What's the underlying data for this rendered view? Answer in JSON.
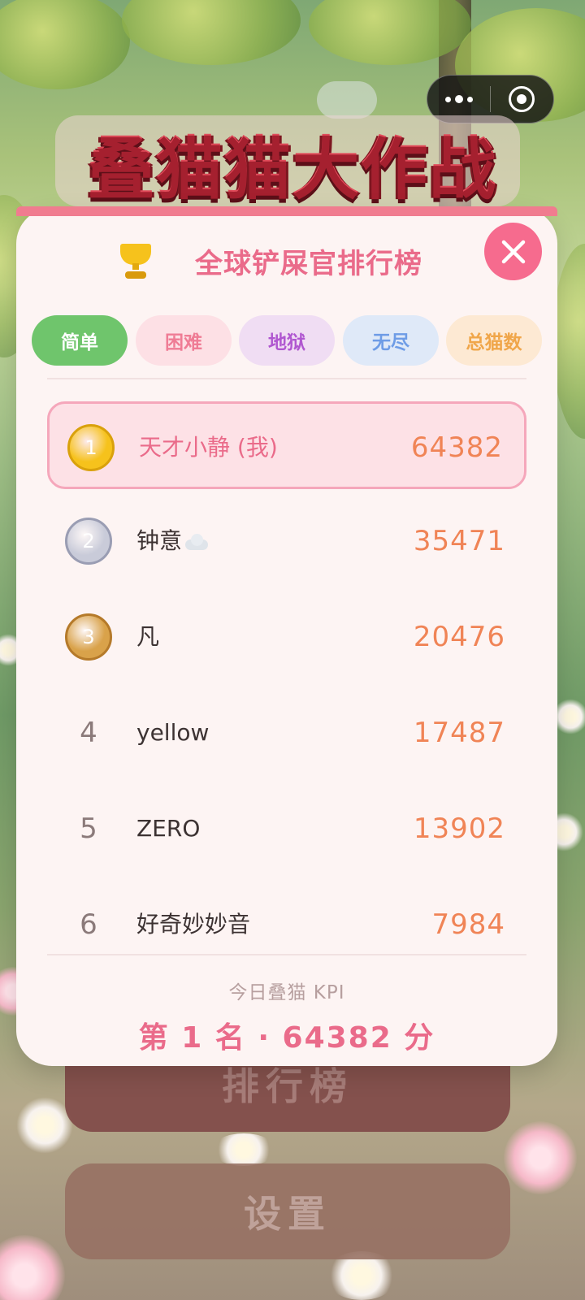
{
  "game": {
    "title": "叠猫猫大作战"
  },
  "capsule": {
    "more_icon": "more-dots-icon",
    "close_icon": "target-close-icon"
  },
  "menu": {
    "leaderboard_label": "排行榜",
    "settings_label": "设置"
  },
  "modal": {
    "title": "全球铲屎官排行榜",
    "trophy_icon": "trophy-icon",
    "close_icon": "close-icon",
    "tabs": [
      {
        "label": "简单",
        "active": true,
        "bg": "#6fc56c",
        "color": "#ffffff"
      },
      {
        "label": "困难",
        "active": false,
        "bg": "#fde0e5",
        "color": "#ef7c95"
      },
      {
        "label": "地狱",
        "active": false,
        "bg": "#f0ddf3",
        "color": "#b057d0"
      },
      {
        "label": "无尽",
        "active": false,
        "bg": "#dfe9f8",
        "color": "#6e9ce6"
      },
      {
        "label": "总猫数",
        "active": false,
        "bg": "#fde9d3",
        "color": "#f0a64a"
      }
    ],
    "rows": [
      {
        "rank": "1",
        "name": "天才小静 (我)",
        "score": "64382",
        "medal": "gold",
        "is_me": true
      },
      {
        "rank": "2",
        "name": "钟意",
        "score": "35471",
        "medal": "silver",
        "is_me": false,
        "emoji": "cloud-icon"
      },
      {
        "rank": "3",
        "name": "凡",
        "score": "20476",
        "medal": "bronze",
        "is_me": false
      },
      {
        "rank": "4",
        "name": "yellow",
        "score": "17487",
        "is_me": false
      },
      {
        "rank": "5",
        "name": "ZERO",
        "score": "13902",
        "is_me": false
      },
      {
        "rank": "6",
        "name": "好奇妙妙音",
        "score": "7984",
        "is_me": false
      }
    ],
    "kpi_label": "今日叠猫 KPI",
    "kpi_value": "第 1 名 · 64382 分"
  },
  "colors": {
    "accent_pink": "#ea6b8a",
    "score_orange": "#f08456",
    "gold": "#f6c21c",
    "silver": "#c9cbd9",
    "bronze": "#d9a24a"
  }
}
